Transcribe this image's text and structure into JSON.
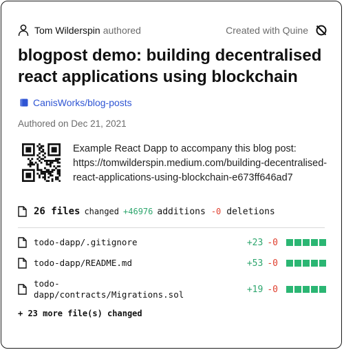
{
  "author": {
    "name": "Tom Wilderspin",
    "verb": "authored"
  },
  "created_with": "Created with Quine",
  "title": "blogpost demo: building decentralised react applications using blockchain",
  "repo": "CanisWorks/blog-posts",
  "date": "Authored on Dec 21, 2021",
  "description": "Example React Dapp to accompany this blog post: https://tomwilderspin.medium.com/building-decentralised-react-applications-using-blockchain-e673ff646ad7",
  "stats": {
    "files": "26 files",
    "changed": "changed",
    "additions": "+46976",
    "additions_label": "additions",
    "deletions": "-0",
    "deletions_label": "deletions"
  },
  "files": [
    {
      "name": "todo-dapp/.gitignore",
      "additions": "+23",
      "deletions": "-0"
    },
    {
      "name": "todo-dapp/README.md",
      "additions": "+53",
      "deletions": "-0"
    },
    {
      "name": "todo-dapp/contracts/Migrations.sol",
      "name_line1": "todo-",
      "name_line2": "dapp/contracts/Migrations.sol",
      "additions": "+19",
      "deletions": "-0"
    }
  ],
  "more_files": "+ 23 more file(s) changed",
  "icons": {
    "author": "person-icon",
    "quine": "quine-logo-icon",
    "repo": "book-icon",
    "qr": "qr-code",
    "file": "file-icon"
  },
  "colors": {
    "link": "#2f55d4",
    "addition": "#2ea66e",
    "deletion": "#e0402f",
    "bar": "#2bb673"
  }
}
